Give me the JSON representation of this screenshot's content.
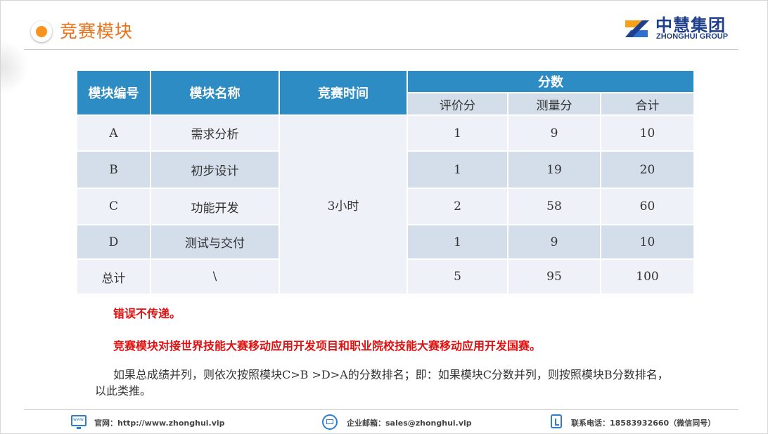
{
  "header": {
    "title": "竞赛模块",
    "logo_cn": "中慧集团",
    "logo_en": "ZHONGHUI GROUP"
  },
  "table": {
    "headers": {
      "module_code": "模块编号",
      "module_name": "模块名称",
      "time": "竞赛时间",
      "score": "分数",
      "eval": "评价分",
      "measure": "测量分",
      "total": "合计"
    },
    "time_value": "3小时",
    "rows": [
      {
        "code": "A",
        "name": "需求分析",
        "eval": "1",
        "measure": "9",
        "total": "10"
      },
      {
        "code": "B",
        "name": "初步设计",
        "eval": "1",
        "measure": "19",
        "total": "20"
      },
      {
        "code": "C",
        "name": "功能开发",
        "eval": "2",
        "measure": "58",
        "total": "60"
      },
      {
        "code": "D",
        "name": "测试与交付",
        "eval": "1",
        "measure": "9",
        "total": "10"
      },
      {
        "code": "总计",
        "name": "\\",
        "eval": "5",
        "measure": "95",
        "total": "100"
      }
    ]
  },
  "notes": {
    "line1": "错误不传递。",
    "line2": "竞赛模块对接世界技能大赛移动应用开发项目和职业院校技能大赛移动应用开发国赛。",
    "line3": "如果总成绩并列，则依次按照模块C>B >D>A的分数排名；即：如果模块C分数并列，则按照模块B分数排名，以此类推。"
  },
  "footer": {
    "website": "官网：http://www.zhonghui.vip",
    "email": "企业邮箱：sales@zhonghui.vip",
    "phone": "联系电话：18583932660（微信同号）"
  },
  "colors": {
    "accent": "#f7931e",
    "header_blue": "#2e8cc5",
    "warning_red": "#e01010",
    "logo_blue": "#1e3f8a"
  }
}
